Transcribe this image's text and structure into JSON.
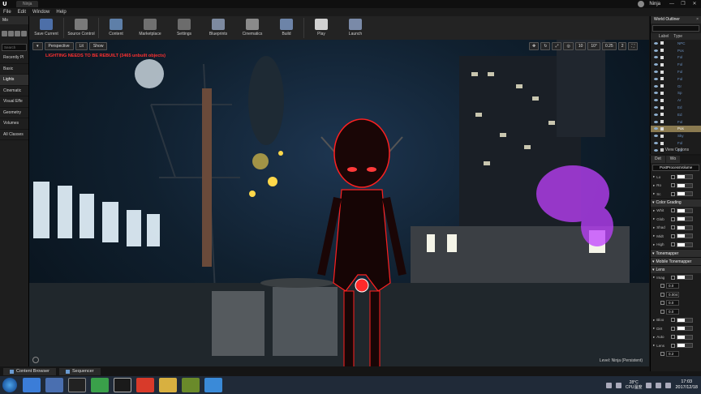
{
  "titlebar": {
    "doc_tab": "Ninja",
    "user_name": "Ninja",
    "min": "—",
    "max": "❐",
    "close": "✕"
  },
  "menu": [
    "File",
    "Edit",
    "Window",
    "Help"
  ],
  "toolbar": [
    {
      "label": "Save Current",
      "icon": "save-icon",
      "color": "#4d6fa8"
    },
    {
      "label": "Source Control",
      "icon": "source-control-icon",
      "color": "#7a7a7a"
    },
    {
      "label": "Content",
      "icon": "content-icon",
      "color": "#5e7fa8"
    },
    {
      "label": "Marketplace",
      "icon": "marketplace-icon",
      "color": "#707070"
    },
    {
      "label": "Settings",
      "icon": "settings-icon",
      "color": "#6c6c6c"
    },
    {
      "label": "Blueprints",
      "icon": "blueprints-icon",
      "color": "#7d8aa0"
    },
    {
      "label": "Cinematics",
      "icon": "cinematics-icon",
      "color": "#8a8a8a"
    },
    {
      "label": "Build",
      "icon": "build-icon",
      "color": "#6d84a8"
    },
    {
      "label": "Play",
      "icon": "play-icon",
      "color": "#d0d0d0"
    },
    {
      "label": "Launch",
      "icon": "launch-icon",
      "color": "#7a8aa8"
    }
  ],
  "modes": {
    "tab": "Mo",
    "search_placeholder": "Search",
    "categories": [
      "Recently Pl",
      "Basic",
      "Lights",
      "Cinematic",
      "Visual Effe",
      "Geometry",
      "Volumes",
      "All Classes"
    ],
    "active_index": 2
  },
  "viewport": {
    "perspective": "Perspective",
    "lit": "Lit",
    "show": "Show",
    "warning": "LIGHTING NEEDS TO BE REBUILT (3465 unbuilt objects)",
    "level": "Level: Ninja (Persistent)",
    "grid_size": "10",
    "rot_snap": "10°",
    "scale_snap": "0.25",
    "cam_speed": "2"
  },
  "outliner": {
    "tab": "World Outliner",
    "col_label": "Label",
    "col_type": "Type",
    "rows": [
      "NPC",
      "Pos",
      "Fol",
      "Fol",
      "Fol",
      "Fol",
      "Gr",
      "Sp",
      "Ar",
      "Ed",
      "Ed",
      "Fol",
      "Pos",
      "Sky",
      "Fol",
      "Fol"
    ],
    "selected_index": 12,
    "view_options": "View Options"
  },
  "details": {
    "tabs": [
      "Det",
      "Wo"
    ],
    "object_name": "PostProcessVolume",
    "rows": [
      {
        "type": "row",
        "label": "Lo"
      },
      {
        "type": "row",
        "label": "Ro"
      },
      {
        "type": "row",
        "label": "Sc"
      },
      {
        "type": "section",
        "label": "Color Grading"
      },
      {
        "type": "row",
        "label": "Whit"
      },
      {
        "type": "row",
        "label": "Glob"
      },
      {
        "type": "row",
        "label": "Shad"
      },
      {
        "type": "row",
        "label": "Midt"
      },
      {
        "type": "row",
        "label": "High"
      },
      {
        "type": "section",
        "label": "Tonemapper"
      },
      {
        "type": "section",
        "label": "Mobile Tonemapper"
      },
      {
        "type": "section",
        "label": "Lens"
      },
      {
        "type": "row",
        "label": "Imag"
      },
      {
        "type": "val",
        "label": "",
        "value": "0.0"
      },
      {
        "type": "val",
        "label": "",
        "value": "0.004"
      },
      {
        "type": "val",
        "label": "",
        "value": "0.0"
      },
      {
        "type": "val",
        "label": "",
        "value": "0.0"
      },
      {
        "type": "row",
        "label": "Bloo"
      },
      {
        "type": "row",
        "label": "Dirt"
      },
      {
        "type": "row",
        "label": "Auto"
      },
      {
        "type": "row",
        "label": "Lens"
      },
      {
        "type": "val",
        "label": "",
        "value": "0.2"
      }
    ]
  },
  "bottom_tabs": [
    "Content Browser",
    "Sequencer"
  ],
  "taskbar": {
    "temperature": "28°C",
    "cpu": "CPU温度",
    "time": "17:03",
    "date": "2017/12/18"
  }
}
